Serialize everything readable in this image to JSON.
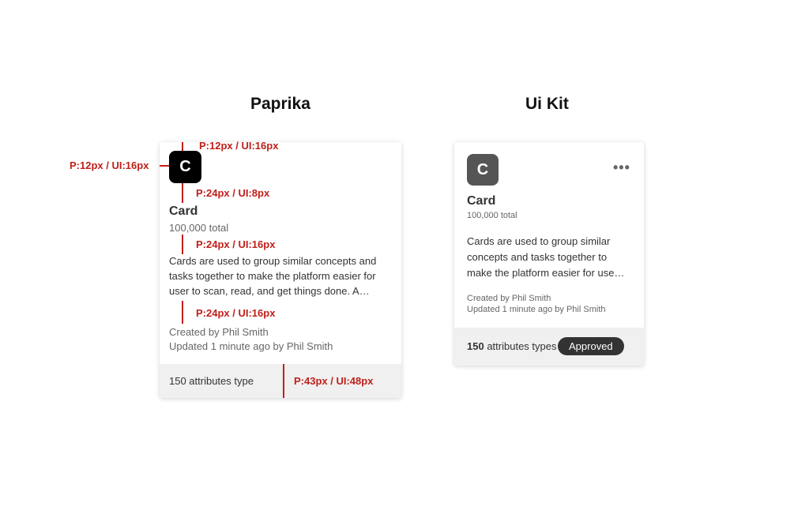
{
  "headings": {
    "paprika": "Paprika",
    "uikit": "Ui Kit"
  },
  "card": {
    "avatar_letter": "C",
    "title": "Card",
    "total": "100,000 total",
    "description_paprika": "Cards are used to group similar concepts and tasks together to make the platform easier for user to scan, read, and get things done. A…",
    "description_uikit": "Cards are used to group similar concepts and tasks together to make the platform easier for use…",
    "created_by": "Created by Phil Smith",
    "updated": "Updated 1 minute ago by Phil Smith",
    "footer_paprika": "150 attributes type",
    "footer_uikit_count": "150",
    "footer_uikit_rest": "attributes types",
    "badge": "Approved",
    "menu_icon": "more-horizontal-icon"
  },
  "annotations": {
    "left_pad": "P:12px  / UI:16px",
    "top_pad": "P:12px  / UI:16px",
    "avatar_gap": "P:24px  / UI:8px",
    "title_gap": "P:24px  / UI:16px",
    "desc_gap": "P:24px  / UI:16px",
    "footer_height": "P:43px  / UI:48px"
  },
  "colors": {
    "annotation": "#c0201a",
    "avatar_paprika": "#000000",
    "avatar_uikit": "#555555",
    "badge": "#333333",
    "footer": "#f0f0f0"
  }
}
